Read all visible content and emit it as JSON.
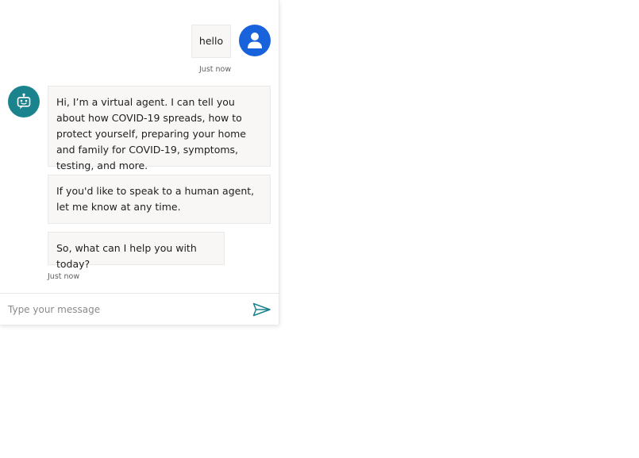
{
  "transcript": {
    "user_message": {
      "text": "hello",
      "timestamp": "Just now"
    },
    "bot_messages": [
      {
        "text": "Hi, I’m a virtual agent. I can tell you about how COVID-19 spreads, how to protect yourself, preparing your home and family for COVID-19, symptoms, testing, and more."
      },
      {
        "text": "If you'd like to speak to a human agent, let me know at any time."
      },
      {
        "text": "So, what can I help you with today?"
      }
    ],
    "bot_timestamp": "Just now"
  },
  "sendbox": {
    "placeholder": "Type your message",
    "value": ""
  },
  "colors": {
    "user_avatar": "#1863dc",
    "bot_avatar": "#1a838d",
    "send_icon": "#1a838d",
    "bubble_bg": "#f8f7f6"
  },
  "icons": {
    "user_avatar": "person-icon",
    "bot_avatar": "robot-icon",
    "send": "send-icon"
  }
}
